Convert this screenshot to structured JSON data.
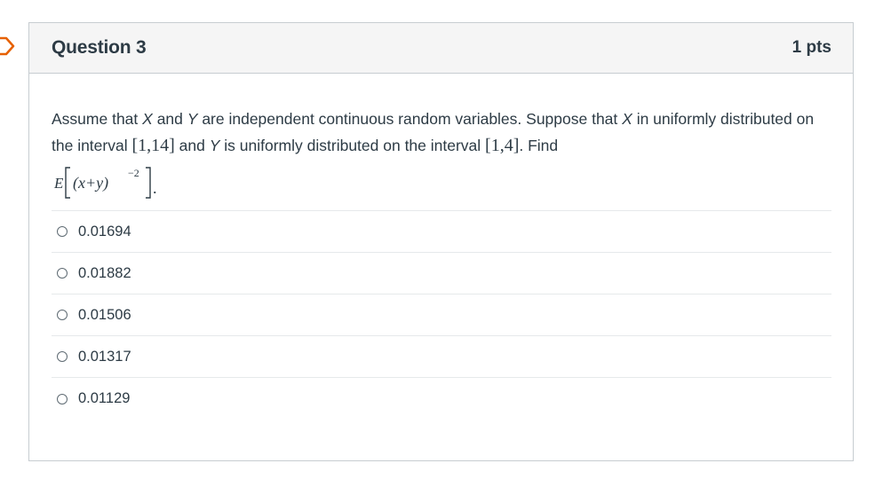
{
  "question": {
    "title": "Question 3",
    "points": "1 pts",
    "text": {
      "intro": "Assume that ",
      "var_x": "X",
      "and": " and ",
      "var_y": "Y",
      "part2": " are independent continuous random variables. Suppose that ",
      "var_x2": "X",
      "part3": " in uniformly distributed on the interval ",
      "interval_x": "[1,14]",
      "part4": " and ",
      "var_y2": "Y",
      "part5": " is uniformly distributed on the interval ",
      "interval_y": "[1,4]",
      "part6": ". Find",
      "formula_E": "E",
      "formula_body": "(x+y)",
      "formula_exp": "−2",
      "formula_end": "."
    }
  },
  "answers": [
    {
      "label": "0.01694"
    },
    {
      "label": "0.01882"
    },
    {
      "label": "0.01506"
    },
    {
      "label": "0.01317"
    },
    {
      "label": "0.01129"
    }
  ],
  "colors": {
    "header_bg": "#f5f5f5",
    "border": "#c7cdd1",
    "text": "#2d3b45",
    "flag_accent": "#e66000"
  },
  "icons": {
    "flag": "question-flag-icon",
    "radio": "radio-unchecked-icon"
  }
}
